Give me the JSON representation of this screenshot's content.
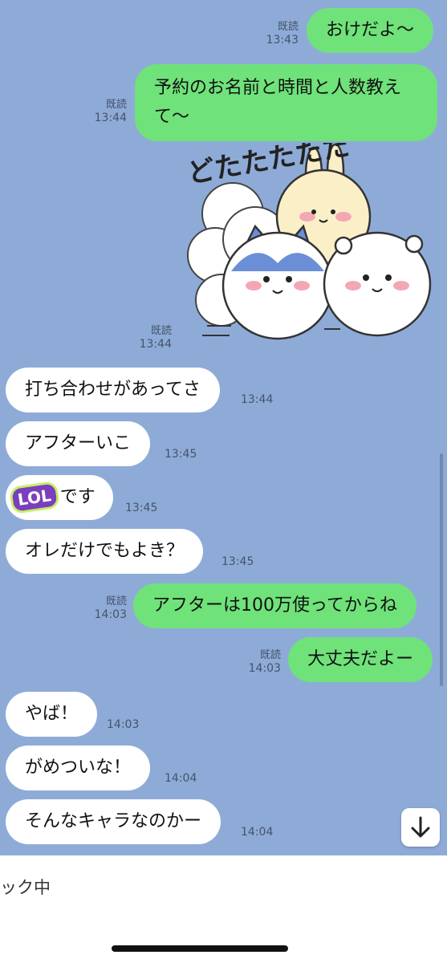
{
  "messages": [
    {
      "text": "おけだよ〜",
      "read": "既読",
      "time": "13:43"
    },
    {
      "text": "予約のお名前と時間と人数教えて〜",
      "read": "既読",
      "time": "13:44"
    },
    {
      "sticker_text": "どたたたたた",
      "read": "既読",
      "time": "13:44"
    },
    {
      "text": "打ち合わせがあってさ",
      "time": "13:44"
    },
    {
      "text": "アフターいこ",
      "time": "13:45"
    },
    {
      "emoji": "LOL",
      "text": "です",
      "time": "13:45"
    },
    {
      "text": "オレだけでもよき？",
      "time": "13:45"
    },
    {
      "text": "アフターは100万使ってからね",
      "read": "既読",
      "time": "14:03"
    },
    {
      "text": "大丈夫だよー",
      "read": "既読",
      "time": "14:03"
    },
    {
      "text": "やば！",
      "time": "14:03"
    },
    {
      "text": "がめついな！",
      "time": "14:04"
    },
    {
      "text": "そんなキャラなのかー",
      "time": "14:04"
    }
  ],
  "scroll_button_icon": "arrow-down-icon",
  "input_bar": {
    "partial_text": "ック中"
  },
  "colors": {
    "background": "#8eabd8",
    "outgoing": "#6fe27a",
    "incoming": "#ffffff"
  }
}
